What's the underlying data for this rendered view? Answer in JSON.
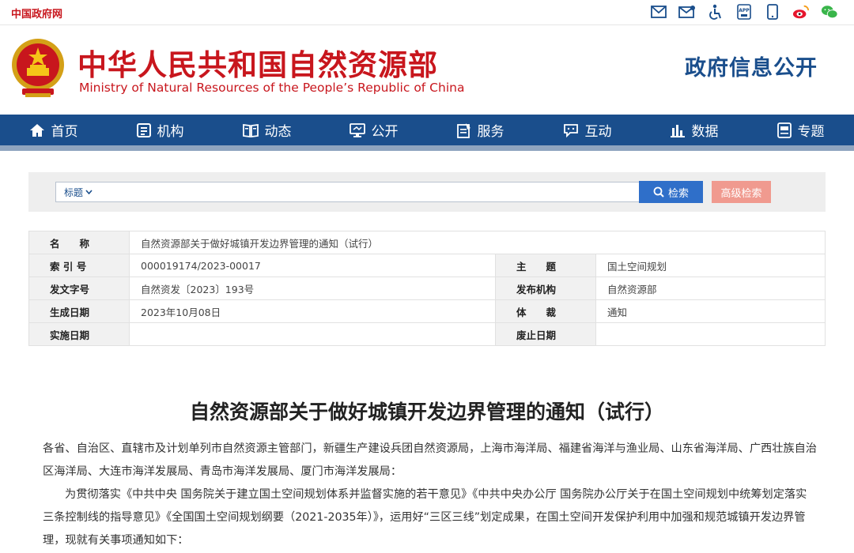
{
  "topbar": {
    "gov_link": "中国政府网",
    "icons": [
      "email-icon",
      "mailbox-icon",
      "accessibility-icon",
      "app-icon",
      "mobile-icon",
      "weibo-icon",
      "wechat-icon"
    ]
  },
  "header": {
    "title": "中华人民共和国自然资源部",
    "subtitle": "Ministry of Natural Resources of the People’s Republic of China",
    "section": "政府信息公开"
  },
  "colors": {
    "brand_red": "#c8161d",
    "nav_blue": "#1a4e8c",
    "search_blue": "#2f6fc9",
    "advanced_pink": "#f09a8f"
  },
  "nav": {
    "items": [
      {
        "label": "首页",
        "icon": "home-icon"
      },
      {
        "label": "机构",
        "icon": "org-icon"
      },
      {
        "label": "动态",
        "icon": "news-icon"
      },
      {
        "label": "公开",
        "icon": "disclosure-icon"
      },
      {
        "label": "服务",
        "icon": "service-icon"
      },
      {
        "label": "互动",
        "icon": "chat-icon"
      },
      {
        "label": "数据",
        "icon": "chart-icon"
      },
      {
        "label": "专题",
        "icon": "topic-icon"
      }
    ]
  },
  "search": {
    "field": "标题",
    "value": "",
    "search_label": "检索",
    "advanced_label": "高级检索"
  },
  "meta": {
    "name_label": "名　　称",
    "name_value": "自然资源部关于做好城镇开发边界管理的通知（试行）",
    "index_label": "索 引 号",
    "index_value": "000019174/2023-00017",
    "topic_label": "主　　题",
    "topic_value": "国土空间规划",
    "docno_label": "发文字号",
    "docno_value": "自然资发〔2023〕193号",
    "issuer_label": "发布机构",
    "issuer_value": "自然资源部",
    "date_label": "生成日期",
    "date_value": "2023年10月08日",
    "genre_label": "体　　裁",
    "genre_value": "通知",
    "effective_label": "实施日期",
    "effective_value": "",
    "expiry_label": "废止日期",
    "expiry_value": ""
  },
  "article": {
    "title": "自然资源部关于做好城镇开发边界管理的通知（试行）",
    "p1": "各省、自治区、直辖市及计划单列市自然资源主管部门，新疆生产建设兵团自然资源局，上海市海洋局、福建省海洋与渔业局、山东省海洋局、广西壮族自治区海洋局、大连市海洋发展局、青岛市海洋发展局、厦门市海洋发展局：",
    "p2": "为贯彻落实《中共中央 国务院关于建立国土空间规划体系并监督实施的若干意见》《中共中央办公厅 国务院办公厅关于在国土空间规划中统筹划定落实三条控制线的指导意见》《全国国土空间规划纲要（2021-2035年）》，运用好“三区三线”划定成果，在国土空间开发保护利用中加强和规范城镇开发边界管理，现就有关事项通知如下："
  }
}
